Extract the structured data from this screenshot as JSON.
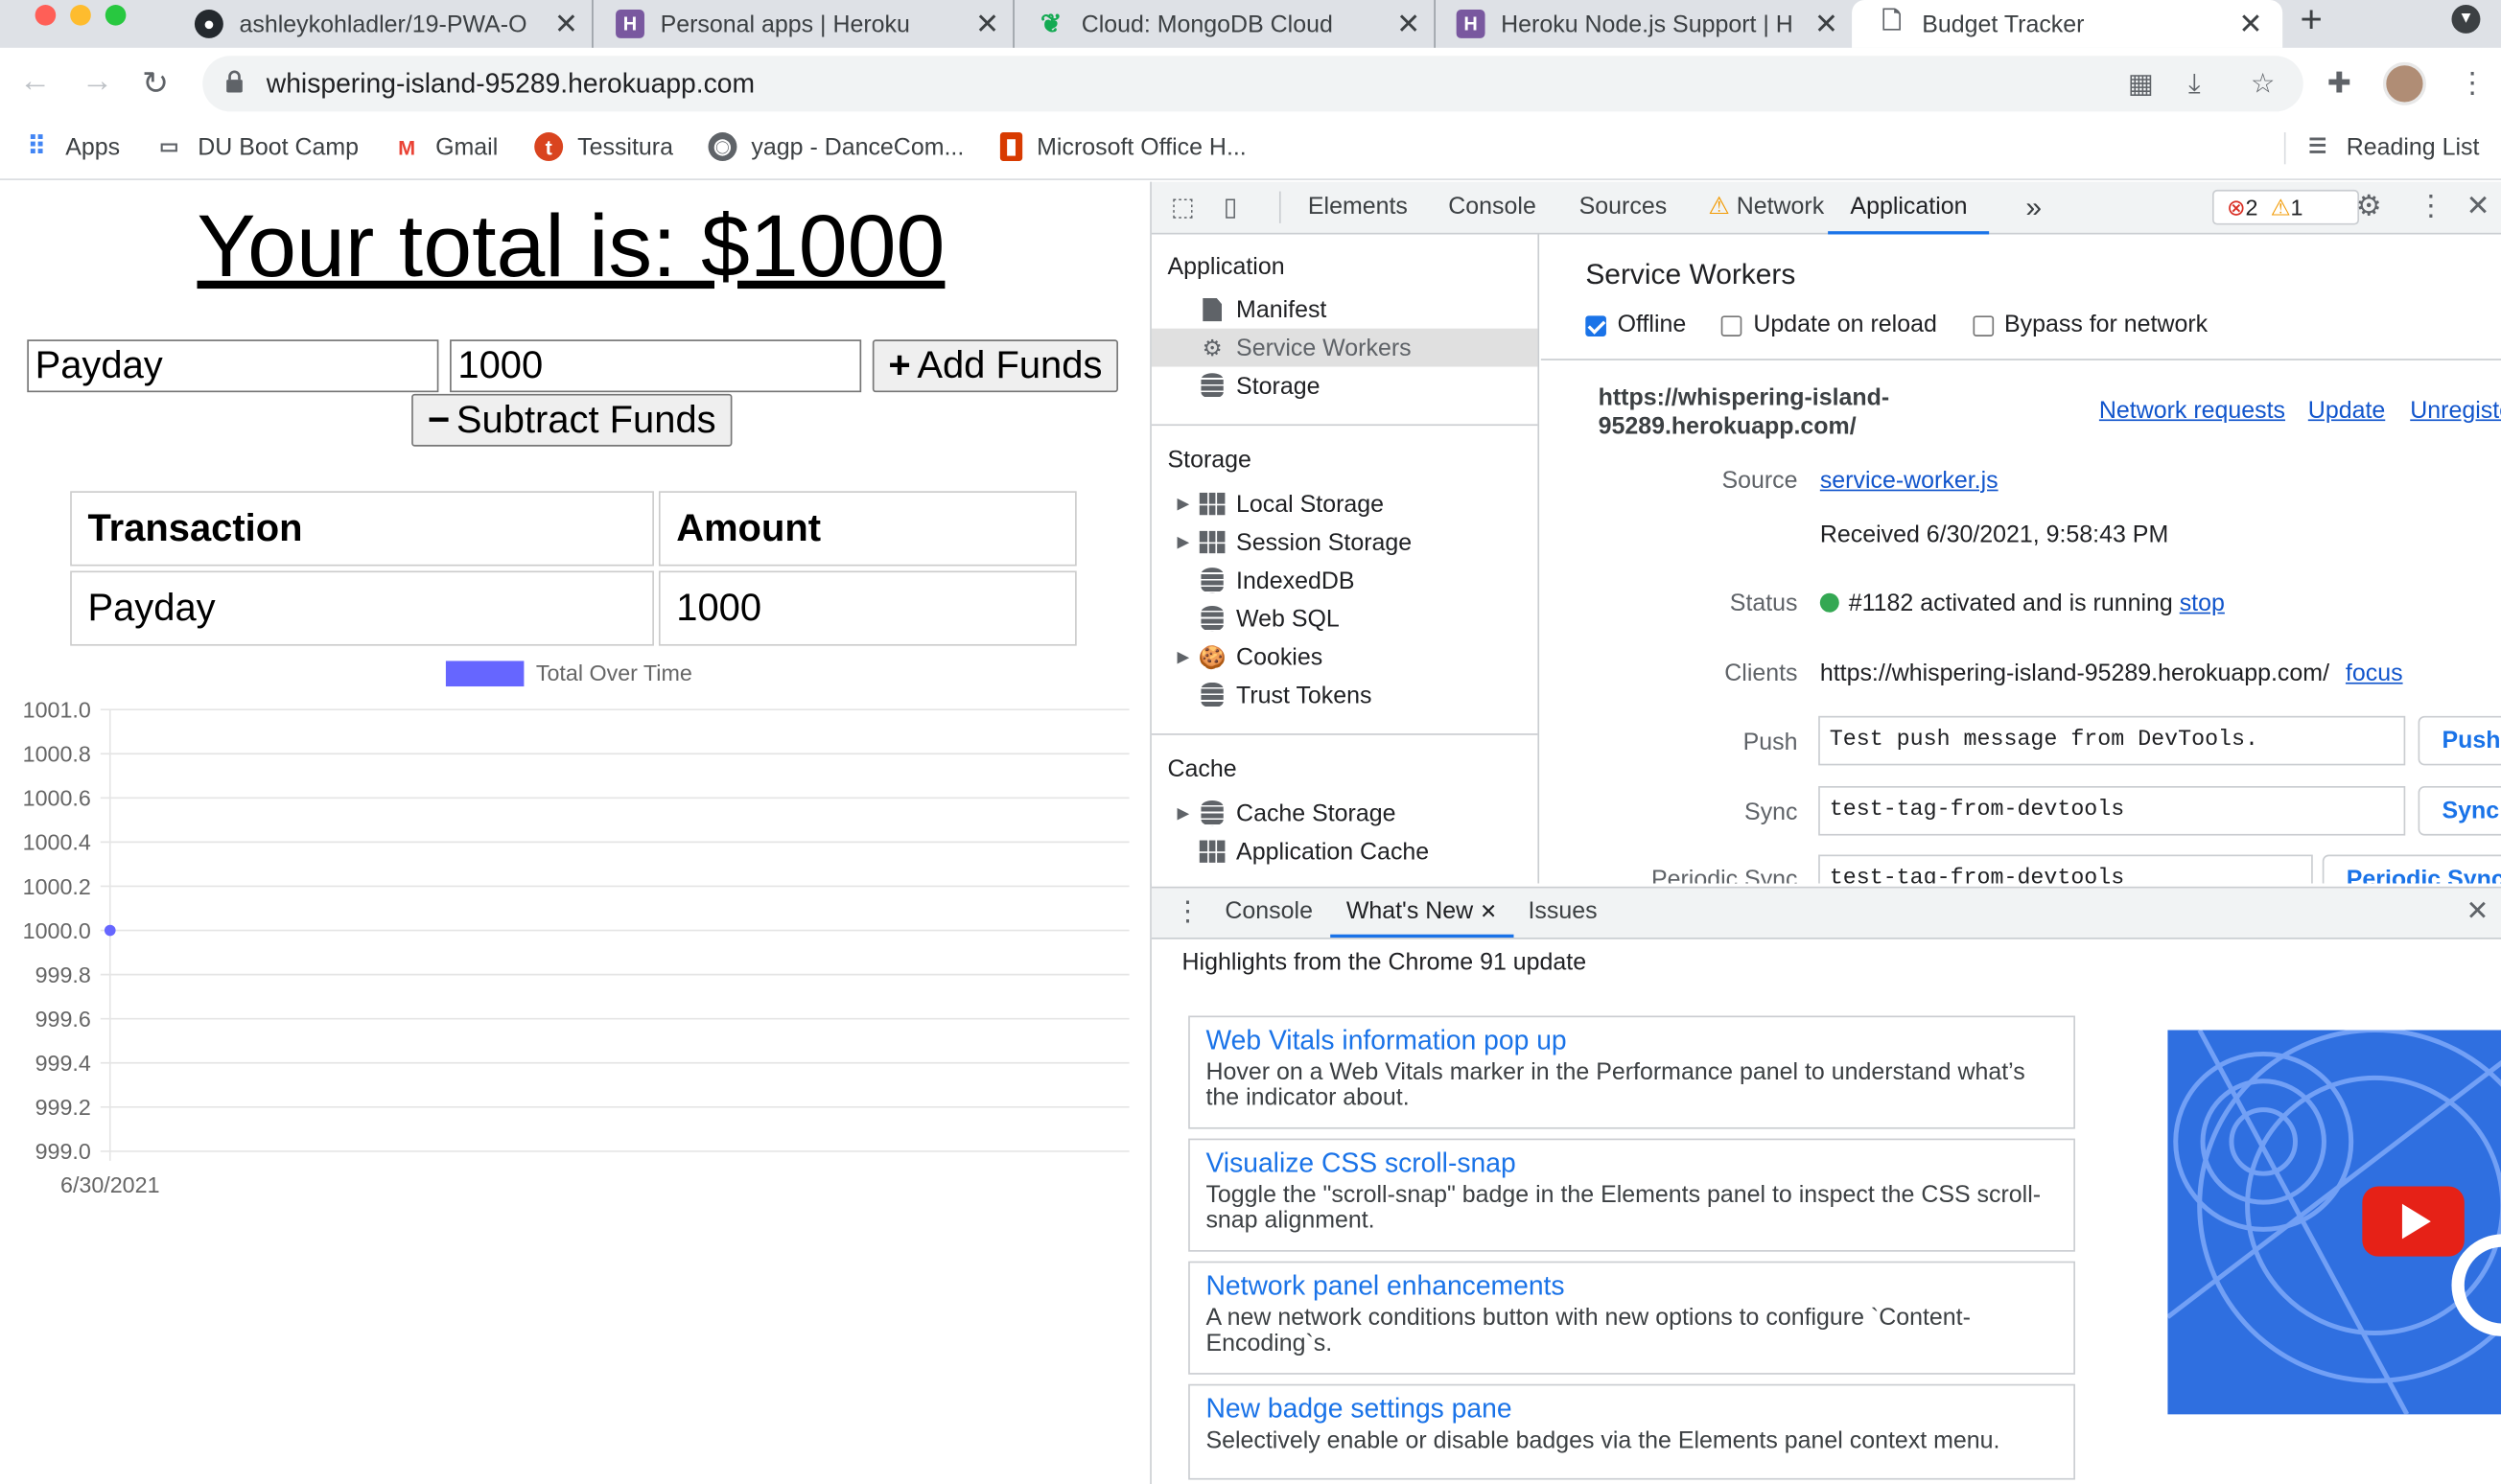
{
  "browser": {
    "tabs": [
      {
        "title": "ashleykohladler/19-PWA-O",
        "favicon": "github-icon"
      },
      {
        "title": "Personal apps | Heroku",
        "favicon": "heroku-icon"
      },
      {
        "title": "Cloud: MongoDB Cloud",
        "favicon": "mongodb-leaf-icon"
      },
      {
        "title": "Heroku Node.js Support | H",
        "favicon": "heroku-icon"
      },
      {
        "title": "Budget Tracker",
        "favicon": "document-icon",
        "active": true
      }
    ],
    "url": "whispering-island-95289.herokuapp.com",
    "bookmarks": [
      {
        "label": "Apps",
        "icon": "apps-grid-icon"
      },
      {
        "label": "DU Boot Camp",
        "icon": "folder-icon"
      },
      {
        "label": "Gmail",
        "icon": "gmail-icon"
      },
      {
        "label": "Tessitura",
        "icon": "tessitura-icon"
      },
      {
        "label": "yagp - DanceCom...",
        "icon": "globe-icon"
      },
      {
        "label": "Microsoft Office H...",
        "icon": "office-icon"
      }
    ],
    "reading_list": "Reading List"
  },
  "app": {
    "total_text": "Your total is: $1000",
    "name_value": "Payday",
    "amount_value": "1000",
    "add_button": "Add Funds",
    "add_icon": "+",
    "subtract_button": "Subtract Funds",
    "subtract_icon": "−",
    "table": {
      "headers": [
        "Transaction",
        "Amount"
      ],
      "rows": [
        [
          "Payday",
          "1000"
        ]
      ]
    }
  },
  "chart_data": {
    "type": "line",
    "legend": [
      "Total Over Time"
    ],
    "legend_placement": "top-center",
    "x": [
      "6/30/2021"
    ],
    "series": [
      {
        "name": "Total Over Time",
        "values": [
          1000
        ],
        "color": "#6666ff"
      }
    ],
    "yticks": [
      "1001.0",
      "1000.8",
      "1000.6",
      "1000.4",
      "1000.2",
      "1000.0",
      "999.8",
      "999.6",
      "999.4",
      "999.2",
      "999.0"
    ],
    "ylim": [
      999.0,
      1001.0
    ],
    "grid": true
  },
  "devtools": {
    "tabs": [
      "Elements",
      "Console",
      "Sources",
      "Network",
      "Application"
    ],
    "more": "»",
    "errors": "2",
    "warnings": "1",
    "sidebar": {
      "application_header": "Application",
      "application_items": [
        "Manifest",
        "Service Workers",
        "Storage"
      ],
      "storage_header": "Storage",
      "storage_items": [
        "Local Storage",
        "Session Storage",
        "IndexedDB",
        "Web SQL",
        "Cookies",
        "Trust Tokens"
      ],
      "cache_header": "Cache",
      "cache_items": [
        "Cache Storage",
        "Application Cache"
      ]
    },
    "sw": {
      "title": "Service Workers",
      "offline": "Offline",
      "update_on_reload": "Update on reload",
      "bypass": "Bypass for network",
      "origin_line1": "https://whispering-island-",
      "origin_line2": "95289.herokuapp.com/",
      "network_requests": "Network requests",
      "update": "Update",
      "unregister": "Unregiste",
      "source_label": "Source",
      "source_value": "service-worker.js",
      "received": "Received 6/30/2021, 9:58:43 PM",
      "status_label": "Status",
      "status_value": "#1182 activated and is running",
      "stop": "stop",
      "clients_label": "Clients",
      "clients_value": "https://whispering-island-95289.herokuapp.com/",
      "focus": "focus",
      "push_label": "Push",
      "push_value": "Test push message from DevTools.",
      "push_button": "Push",
      "sync_label": "Sync",
      "sync_value": "test-tag-from-devtools",
      "sync_button": "Sync",
      "periodic_label": "Periodic Sync",
      "periodic_value": "test-tag-from-devtools",
      "periodic_button": "Periodic Sync"
    },
    "drawer": {
      "tabs": [
        "Console",
        "What's New",
        "Issues"
      ],
      "highlights": "Highlights from the Chrome 91 update",
      "cards": [
        {
          "title": "Web Vitals information pop up",
          "desc": "Hover on a Web Vitals marker in the Performance panel to understand what’s the indicator about."
        },
        {
          "title": "Visualize CSS scroll-snap",
          "desc": "Toggle the \"scroll-snap\" badge in the Elements panel to inspect the CSS scroll-snap alignment."
        },
        {
          "title": "Network panel enhancements",
          "desc": "A new network conditions button with new options to configure `Content-Encoding`s."
        },
        {
          "title": "New badge settings pane",
          "desc": "Selectively enable or disable badges via the Elements panel context menu."
        }
      ]
    }
  }
}
